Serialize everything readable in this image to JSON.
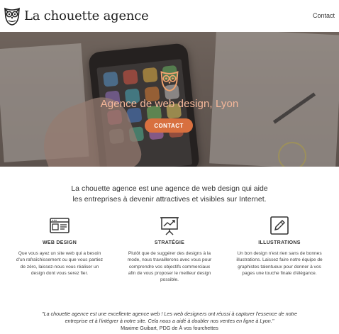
{
  "header": {
    "brand": "La chouette agence",
    "nav_contact": "Contact"
  },
  "hero": {
    "title": "Agence de web design, Lyon",
    "button_label": "CONTACT"
  },
  "intro": {
    "line1": "La chouette agence est une agence de web design qui aide",
    "line2": "les entreprises à devenir attractives et visibles sur Internet."
  },
  "services": [
    {
      "icon": "browser-window-icon",
      "title": "WEB DESIGN",
      "lines": [
        "Que vous ayez un site web qui a besoin",
        "d'un rafraîchissement ou que vous partiez",
        "de zéro, laissez-nous vous réaliser un",
        "design dont vous serez fier."
      ]
    },
    {
      "icon": "presentation-chart-icon",
      "title": "STRATÉGIE",
      "lines": [
        "Plutôt que de suggérer des designs à la",
        "mode, nous travaillerons avec vous pour",
        "comprendre vos objectifs commerciaux",
        "afin de vous proposer le meilleur design",
        "possible."
      ]
    },
    {
      "icon": "pencil-note-icon",
      "title": "ILLUSTRATIONS",
      "lines": [
        "Un bon design n'est rien sans de bonnes",
        "illustrations. Laissez faire notre équipe de",
        "graphistes talentueux pour donner à vos",
        "pages une touche finale d'élégance."
      ]
    }
  ],
  "testimonial": {
    "line1": "\"La chouette agence est une excellente agence web ! Les web designers ont réussi à capturer l'essence de notre",
    "line2": "entreprise et à l'intégrer à notre site. Cela nous a aidé à doubler nos ventes en ligne à Lyon.\"",
    "author": "Maxime Guibart, PDG de À vos fourchettes"
  },
  "colors": {
    "accent": "#d8703f",
    "hero_title": "#f4b79a"
  }
}
